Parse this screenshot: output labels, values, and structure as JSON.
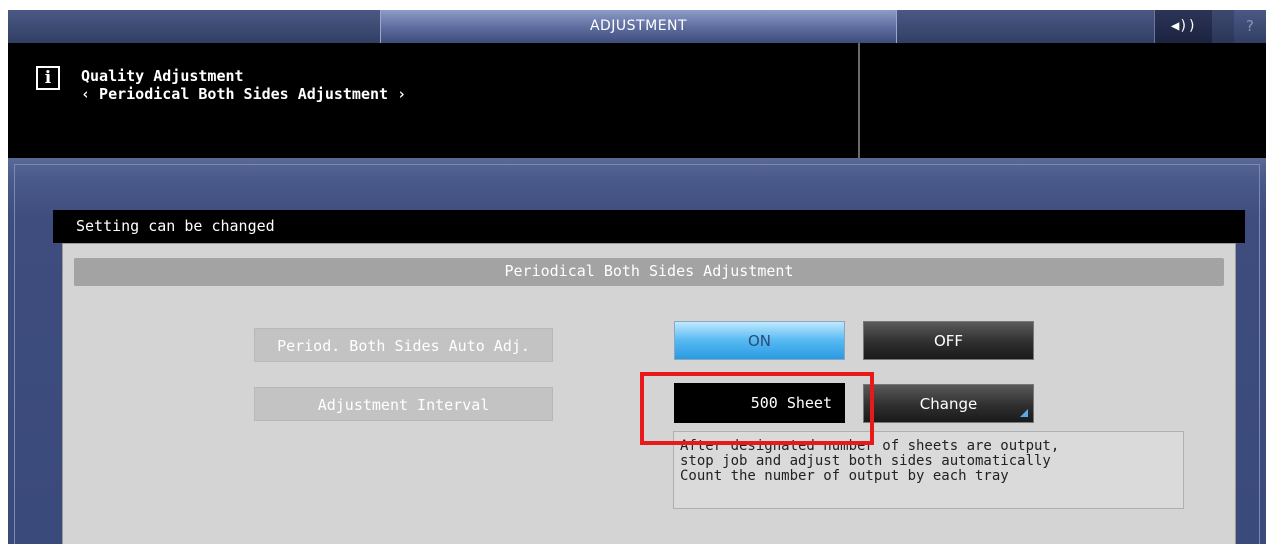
{
  "topbar": {
    "title": "ADJUSTMENT",
    "speaker_icon": "speaker-icon",
    "speaker_glyph": "◀))",
    "help_label": "?"
  },
  "header": {
    "info_icon_glyph": "i",
    "breadcrumb_title": "Quality Adjustment",
    "breadcrumb_sub": "‹ Periodical Both Sides Adjustment ›"
  },
  "status": {
    "text": "Setting can be changed"
  },
  "panel": {
    "section_title": "Periodical Both Sides Adjustment",
    "auto_adj_label": "Period. Both Sides Auto Adj.",
    "on_label": "ON",
    "off_label": "OFF",
    "selected": "ON",
    "interval_label": "Adjustment Interval",
    "interval_value": "500 Sheet",
    "change_label": "Change",
    "note_lines": [
      "After designated number of sheets are output,",
      "stop job and adjust both sides automatically",
      "Count the number of output by each tray"
    ]
  },
  "colors": {
    "on_active": "#56b9f2",
    "highlight": "#e8191b"
  }
}
